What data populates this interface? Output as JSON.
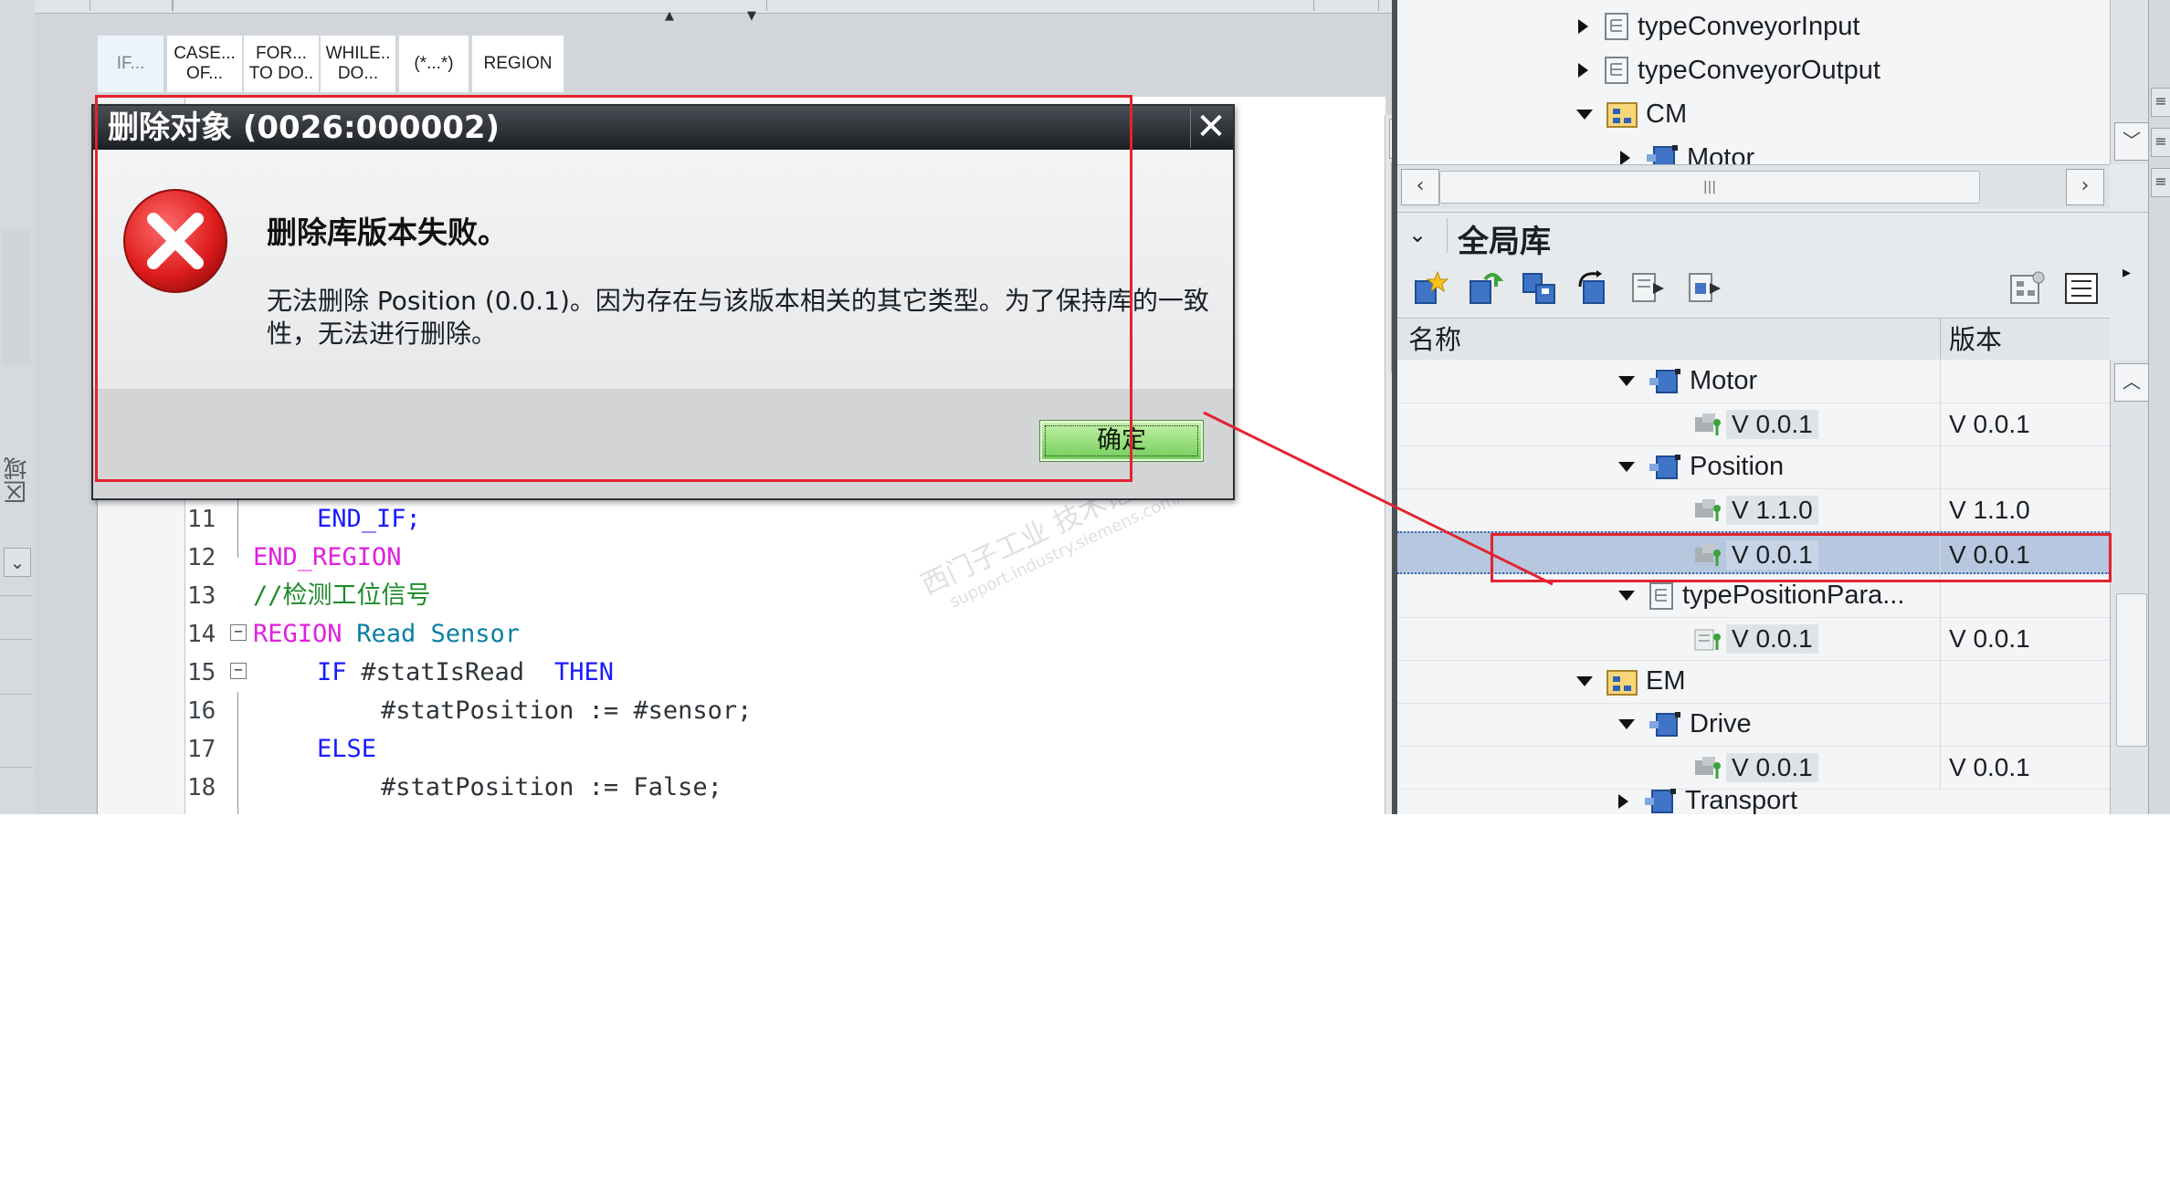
{
  "left_strip": {
    "vertical_label": "区域"
  },
  "kw_toolbar": {
    "buttons": [
      {
        "label1": "IF...",
        "label2": ""
      },
      {
        "label1": "CASE...",
        "label2": "OF..."
      },
      {
        "label1": "FOR...",
        "label2": "TO DO.."
      },
      {
        "label1": "WHILE..",
        "label2": "DO..."
      },
      {
        "label1": "(*...*)",
        "label2": ""
      },
      {
        "label1": "REGION",
        "label2": ""
      }
    ]
  },
  "code": {
    "lines": [
      {
        "num": "11",
        "segments": [
          {
            "t": "END_IF;",
            "c": "kw"
          }
        ]
      },
      {
        "num": "12",
        "segments": [
          {
            "t": "END_REGION",
            "c": "region"
          }
        ]
      },
      {
        "num": "13",
        "segments": [
          {
            "t": "//检测工位信号",
            "c": "comment"
          }
        ]
      },
      {
        "num": "14",
        "segments": [
          {
            "t": "REGION",
            "c": "region"
          },
          {
            "t": " Read Sensor",
            "c": "teal"
          }
        ]
      },
      {
        "num": "15",
        "segments": [
          {
            "t": "IF",
            "c": "kw"
          },
          {
            "t": " #statIsRead ",
            "c": "var"
          },
          {
            "t": "THEN",
            "c": "kw"
          }
        ]
      },
      {
        "num": "16",
        "segments": [
          {
            "t": "#statPosition := #sensor;",
            "c": "var"
          }
        ]
      },
      {
        "num": "17",
        "segments": [
          {
            "t": "ELSE",
            "c": "kw"
          }
        ]
      },
      {
        "num": "18",
        "segments": [
          {
            "t": "#statPosition := False;",
            "c": "var"
          }
        ]
      }
    ]
  },
  "project_tree": {
    "items": [
      {
        "label": "typeConveyorInput",
        "expanded": false
      },
      {
        "label": "typeConveyorOutput",
        "expanded": false
      },
      {
        "label": "CM",
        "expanded": true
      },
      {
        "label": "Motor",
        "expanded": false
      }
    ]
  },
  "library": {
    "title": "全局库",
    "columns": {
      "name": "名称",
      "version": "版本"
    },
    "rows": [
      {
        "name": "Motor",
        "version": "",
        "kind": "type",
        "expanded": true
      },
      {
        "name": "V 0.0.1",
        "version": "V 0.0.1",
        "kind": "version"
      },
      {
        "name": "Position",
        "version": "",
        "kind": "type",
        "expanded": true
      },
      {
        "name": "V 1.1.0",
        "version": "V 1.1.0",
        "kind": "version"
      },
      {
        "name": "V 0.0.1",
        "version": "V 0.0.1",
        "kind": "version",
        "selected": true
      },
      {
        "name": "typePositionPara...",
        "version": "",
        "kind": "udt",
        "expanded": true
      },
      {
        "name": "V 0.0.1",
        "version": "V 0.0.1",
        "kind": "version-udt"
      },
      {
        "name": "EM",
        "version": "",
        "kind": "folder",
        "expanded": true
      },
      {
        "name": "Drive",
        "version": "",
        "kind": "type",
        "expanded": true
      },
      {
        "name": "V 0.0.1",
        "version": "V 0.0.1",
        "kind": "version"
      },
      {
        "name": "Transport",
        "version": "",
        "kind": "type",
        "expanded": false
      }
    ]
  },
  "dialog": {
    "title": "删除对象 (0026:000002)",
    "close_label": "✕",
    "heading": "删除库版本失败。",
    "message": "无法删除 Position (0.0.1)。因为存在与该版本相关的其它类型。为了保持库的一致性，无法进行删除。",
    "ok_label": "确定"
  },
  "watermark": {
    "line1": "西门子工业 技术论坛",
    "line2": "support.industry.siemens.com/cs"
  },
  "colors": {
    "annotation_red": "#e3232f",
    "selection_blue": "#b6c7df",
    "ok_green": "#6fcd57"
  }
}
